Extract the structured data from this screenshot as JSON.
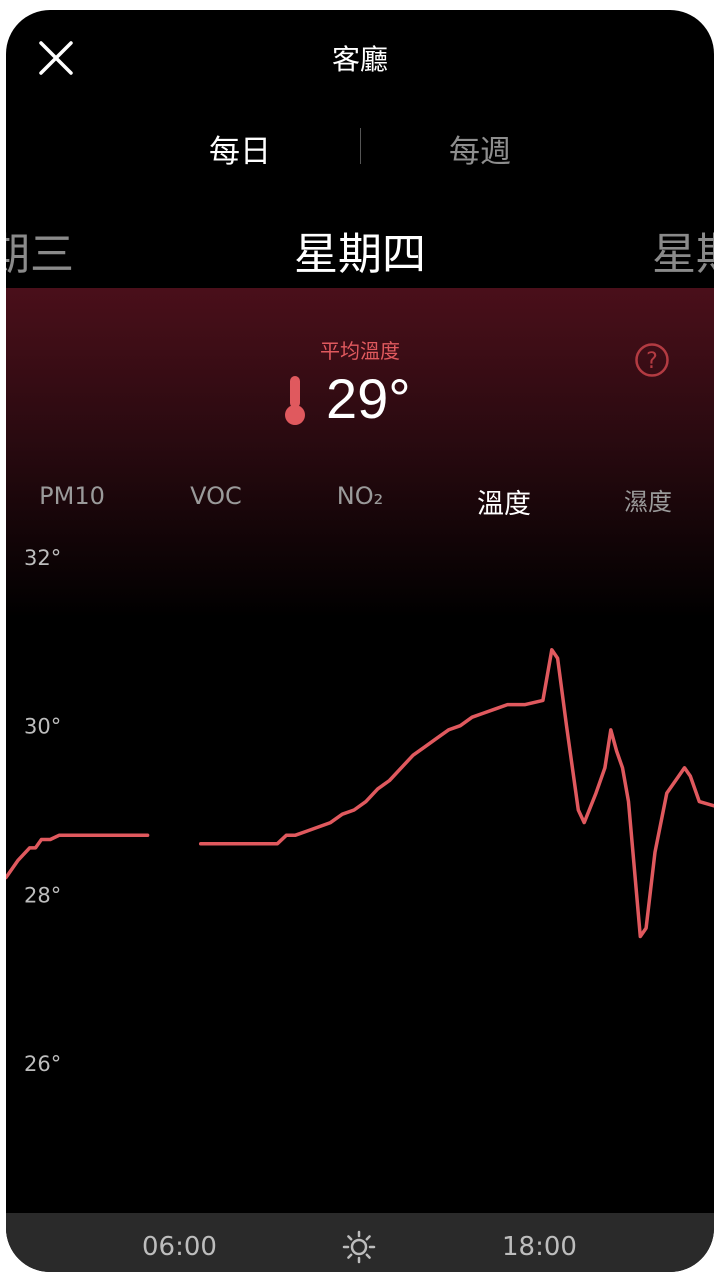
{
  "header": {
    "title": "客廳",
    "close_icon": "close-icon"
  },
  "period_tabs": [
    {
      "label": "每日",
      "active": true
    },
    {
      "label": "每週",
      "active": false
    }
  ],
  "days": {
    "prev": "期三",
    "current": "星期四",
    "next": "星期"
  },
  "summary": {
    "label": "平均溫度",
    "value": "29°",
    "icon": "thermometer-icon",
    "help_icon": "help-icon"
  },
  "metric_tabs": [
    {
      "label": "PM10",
      "active": false
    },
    {
      "label": "VOC",
      "active": false
    },
    {
      "label": "NO₂",
      "active": false
    },
    {
      "label": "溫度",
      "active": true
    },
    {
      "label": "濕度",
      "active": false
    }
  ],
  "chart_data": {
    "type": "line",
    "y_ticks": [
      "32°",
      "30°",
      "28°",
      "26°"
    ],
    "ylim": [
      25,
      32.2
    ],
    "xlim": [
      0,
      24
    ],
    "line_color": "#e0595e",
    "series": [
      {
        "points": [
          [
            0,
            28.2
          ],
          [
            0.4,
            28.4
          ],
          [
            0.8,
            28.55
          ],
          [
            1.0,
            28.55
          ],
          [
            1.2,
            28.65
          ],
          [
            1.5,
            28.65
          ],
          [
            1.8,
            28.7
          ],
          [
            3.0,
            28.7
          ],
          [
            4.0,
            28.7
          ],
          [
            4.8,
            28.7
          ]
        ]
      },
      {
        "points": [
          [
            6.6,
            28.6
          ],
          [
            7.5,
            28.6
          ],
          [
            8.5,
            28.6
          ],
          [
            9.2,
            28.6
          ],
          [
            9.5,
            28.7
          ],
          [
            9.8,
            28.7
          ],
          [
            10.2,
            28.75
          ],
          [
            10.6,
            28.8
          ],
          [
            11.0,
            28.85
          ],
          [
            11.4,
            28.95
          ],
          [
            11.8,
            29.0
          ],
          [
            12.2,
            29.1
          ],
          [
            12.6,
            29.25
          ],
          [
            13.0,
            29.35
          ],
          [
            13.4,
            29.5
          ],
          [
            13.8,
            29.65
          ],
          [
            14.2,
            29.75
          ],
          [
            14.6,
            29.85
          ],
          [
            15.0,
            29.95
          ],
          [
            15.4,
            30.0
          ],
          [
            15.8,
            30.1
          ],
          [
            16.2,
            30.15
          ],
          [
            16.6,
            30.2
          ],
          [
            17.0,
            30.25
          ],
          [
            17.6,
            30.25
          ],
          [
            18.2,
            30.3
          ],
          [
            18.5,
            30.9
          ],
          [
            18.7,
            30.8
          ],
          [
            19.0,
            30.0
          ],
          [
            19.4,
            29.0
          ],
          [
            19.6,
            28.85
          ],
          [
            20.0,
            29.2
          ],
          [
            20.3,
            29.5
          ],
          [
            20.5,
            29.95
          ],
          [
            20.7,
            29.7
          ],
          [
            20.9,
            29.5
          ],
          [
            21.1,
            29.1
          ],
          [
            21.3,
            28.3
          ],
          [
            21.5,
            27.5
          ],
          [
            21.7,
            27.6
          ],
          [
            22.0,
            28.5
          ],
          [
            22.4,
            29.2
          ],
          [
            22.8,
            29.4
          ],
          [
            23.0,
            29.5
          ],
          [
            23.2,
            29.4
          ],
          [
            23.5,
            29.1
          ],
          [
            24.0,
            29.05
          ]
        ]
      }
    ]
  },
  "bottom_bar": {
    "labels": [
      "06:00",
      "18:00"
    ],
    "sun_icon": "sun-icon",
    "moon_icon": "moon-icon"
  }
}
